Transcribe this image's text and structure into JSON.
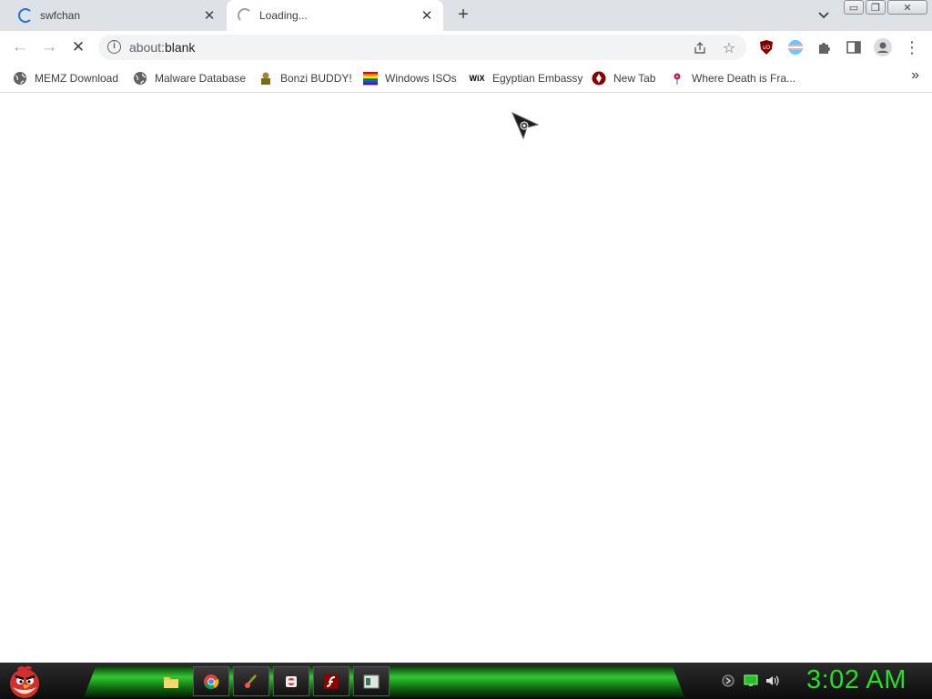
{
  "tabs": [
    {
      "title": "swfchan",
      "close": "✕"
    },
    {
      "title": "Loading...",
      "close": "✕"
    }
  ],
  "new_tab_label": "+",
  "window_controls": {
    "minimize": "▭",
    "restore": "❐",
    "close": "✕"
  },
  "toolbar": {
    "back": "←",
    "forward": "→",
    "reload": "✕",
    "url_scheme": "about:",
    "url_rest": "blank"
  },
  "bookmarks": [
    {
      "label": "MEMZ Download",
      "icon": "globe-icon"
    },
    {
      "label": "Malware Database",
      "icon": "globe-icon"
    },
    {
      "label": "Bonzi BUDDY!",
      "icon": "bonzi-icon"
    },
    {
      "label": "Windows ISOs",
      "icon": "rainbow-flag-icon"
    },
    {
      "label": "Egyptian Embassy",
      "icon": "wix-icon",
      "icon_text": "WiX"
    },
    {
      "label": "New Tab",
      "icon": "red-circle-icon"
    },
    {
      "label": "Where Death is Fra...",
      "icon": "flower-icon"
    }
  ],
  "bookmarks_more": "»",
  "taskbar": {
    "clock": "3:02 AM"
  },
  "colors": {
    "accent_blue": "#1a73e8",
    "taskbar_green": "#31c831",
    "clock_green": "#23e023"
  }
}
